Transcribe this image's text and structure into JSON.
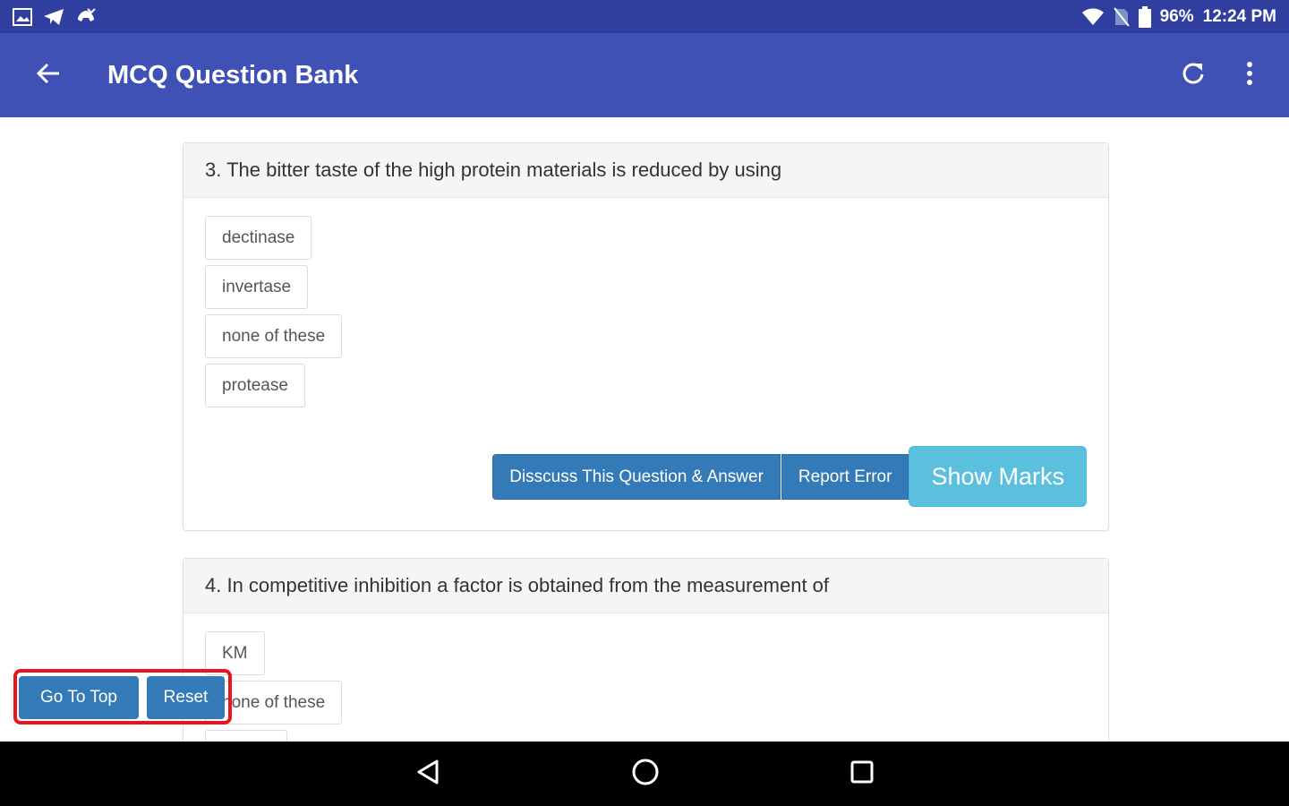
{
  "status_bar": {
    "battery": "96%",
    "time": "12:24 PM",
    "icons": [
      "image-icon",
      "telegram-icon",
      "missed-call-icon",
      "wifi-icon",
      "no-sim-icon",
      "battery-icon"
    ]
  },
  "app_bar": {
    "title": "MCQ Question Bank",
    "icons": [
      "back-arrow-icon",
      "refresh-icon",
      "more-vert-icon"
    ]
  },
  "questions": [
    {
      "text": "3. The bitter taste of the high protein materials is reduced by using",
      "options": [
        "dectinase",
        "invertase",
        "none of these",
        "protease"
      ],
      "discuss_label": "Disscuss This Question & Answer",
      "report_label": "Report Error",
      "show_marks_label": "Show Marks"
    },
    {
      "text": "4. In competitive inhibition a factor is obtained from the measurement of",
      "options": [
        "KM",
        "none of these"
      ]
    }
  ],
  "floating": {
    "go_to_top_label": "Go To Top",
    "reset_label": "Reset",
    "highlight_color": "#e8141e"
  },
  "colors": {
    "status_bar": "#303f9f",
    "app_bar": "#3f51b5",
    "primary_button": "#337ab7",
    "info_button": "#5bc0de"
  },
  "nav_bar": {
    "icons": [
      "nav-back-icon",
      "nav-home-icon",
      "nav-recents-icon"
    ]
  }
}
